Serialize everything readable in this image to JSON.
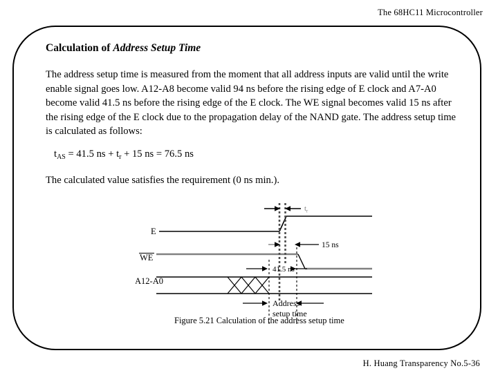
{
  "header": {
    "title": "The 68HC11 Microcontroller"
  },
  "footer": {
    "text": "H. Huang Transparency No.5-36"
  },
  "slide": {
    "title_plain": "Calculation of ",
    "title_emphasis": "Address Setup Time",
    "paragraph_main": "The address setup time is measured from the moment that all address inputs are valid until the write enable signal goes low. A12-A8 become valid 94 ns before the rising edge of E clock and A7-A0 become valid 41.5 ns before the rising edge of the E clock.  The WE signal becomes valid 15 ns after the rising edge of the E clock due to the propagation delay of the NAND gate.  The address setup time is calculated as follows:",
    "equation": {
      "lhs_symbol": "t",
      "lhs_sub": "AS",
      "part1": " = 41.5 ns + t",
      "part1_sub": "r",
      "part2": " + 15 ns = 76.5 ns"
    },
    "paragraph_satisfies": "The calculated value satisfies the requirement (0 ns min.)."
  },
  "figure": {
    "caption": "Figure 5.21 Calculation of the address setup time",
    "signals": {
      "e_label": "E",
      "we_label": "WE",
      "address_label": "A12-A0"
    },
    "annotations": {
      "rise_time": "t",
      "rise_time_sub": "r",
      "we_delay": "15 ns",
      "address_valid": "41.5 ns",
      "setup_line1": "Address",
      "setup_line2": "setup time"
    },
    "colors": {
      "signal_e": "#000000",
      "signal_we": "#808080",
      "signal_address": "#000000",
      "dotted_marker": "#4d4d4d",
      "dashed_marker": "#000000"
    }
  }
}
